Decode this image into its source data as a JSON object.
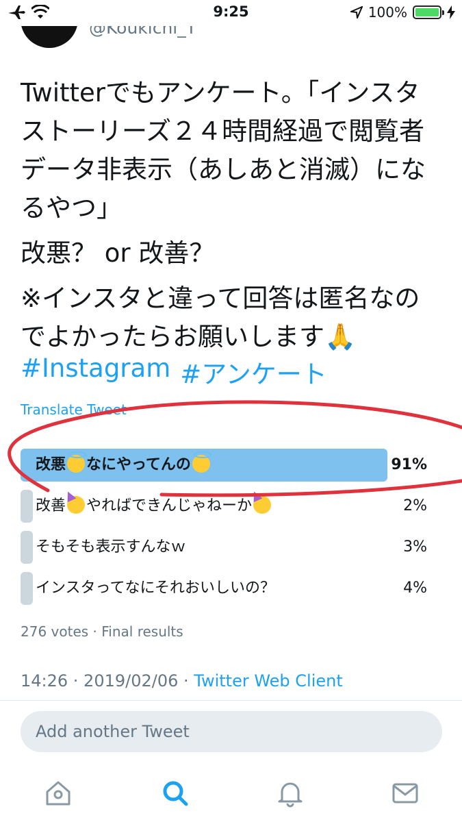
{
  "status_bar": {
    "time": "9:25",
    "battery": "100%",
    "battery_level": 1.0
  },
  "tweet": {
    "handle": "@Koukichi_T",
    "text_paragraphs": [
      "Twitterでもアンケート。「インスタストーリーズ２４時間経過で閲覧者データ非表示（あしあと消滅）になるやつ」",
      "改悪？ or 改善？",
      "※インスタと違って回答は匿名なのでよかったらお願いします🙏"
    ],
    "hashtags": [
      "#Instagram",
      "#アンケート"
    ],
    "translate_label": "Translate Tweet"
  },
  "poll": {
    "options": [
      {
        "label_parts": [
          "改悪",
          "なにやってんの"
        ],
        "emoji": "halo",
        "percent_label": "91%",
        "percent": 91,
        "winner": true
      },
      {
        "label_parts": [
          "改善",
          "やればできんじゃねーか"
        ],
        "emoji": "party",
        "percent_label": "2%",
        "percent": 2,
        "winner": false
      },
      {
        "label_parts": [
          "そもそも表示すんなｗ"
        ],
        "emoji": "",
        "percent_label": "3%",
        "percent": 3,
        "winner": false
      },
      {
        "label_parts": [
          "インスタってなにそれおいしいの？"
        ],
        "emoji": "",
        "percent_label": "4%",
        "percent": 4,
        "winner": false
      }
    ],
    "votes": "276 votes · Final results"
  },
  "meta": {
    "time_date": "14:26 · 2019/02/06 · ",
    "client": "Twitter Web Client"
  },
  "reply": {
    "placeholder": "Add another Tweet"
  },
  "tabs": [
    "home-icon",
    "search-icon",
    "notifications-icon",
    "messages-icon"
  ],
  "colors": {
    "accent": "#1da1f2",
    "winner_bar": "#7ec0ee",
    "bar": "#ccd6dd",
    "annotation": "#e0323c"
  }
}
